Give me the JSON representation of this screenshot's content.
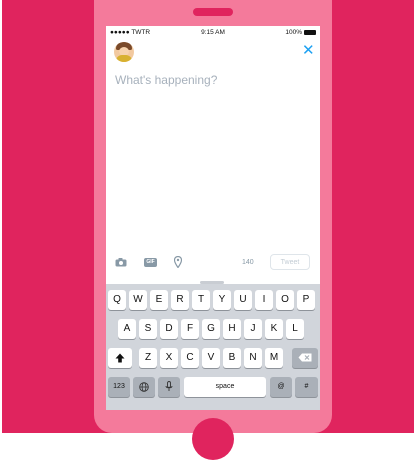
{
  "status_bar": {
    "carrier": "●●●●● TWTR",
    "time": "9:15 AM",
    "battery": "100%"
  },
  "compose": {
    "placeholder": "What's happening?"
  },
  "toolbar": {
    "char_count": "140",
    "tweet_label": "Tweet",
    "gif_label": "GIF"
  },
  "keyboard": {
    "row1": [
      "Q",
      "W",
      "E",
      "R",
      "T",
      "Y",
      "U",
      "I",
      "O",
      "P"
    ],
    "row2": [
      "A",
      "S",
      "D",
      "F",
      "G",
      "H",
      "J",
      "K",
      "L"
    ],
    "row3": [
      "Z",
      "X",
      "C",
      "V",
      "B",
      "N",
      "M"
    ],
    "numbers": "123",
    "space": "space",
    "at": "@",
    "hash": "#"
  },
  "colors": {
    "brand_pink": "#e0245e",
    "phone_body": "#f47a9b",
    "accent_blue": "#1da1f2"
  }
}
